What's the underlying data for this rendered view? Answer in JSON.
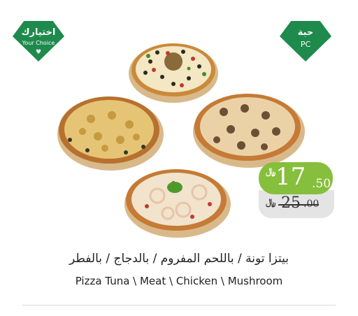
{
  "badge_left": {
    "arabic": "اختيارك",
    "english": "Your Choice"
  },
  "badge_right": {
    "arabic": "حبة",
    "english": "PC"
  },
  "price": {
    "currency_symbol": "﷼",
    "current_integer": "17",
    "current_decimal": ".50",
    "old_integer": "25",
    "old_decimal": ".00"
  },
  "product": {
    "title_ar": "بيتزا تونة / باللحم المفروم / بالدجاج / بالفطر",
    "title_en": "Pizza Tuna \\ Meat \\ Chicken \\ Mushroom"
  },
  "colors": {
    "badge_green": "#1e8a4c",
    "price_green": "#86bf3b",
    "old_price_bg": "#e4e4e4"
  }
}
